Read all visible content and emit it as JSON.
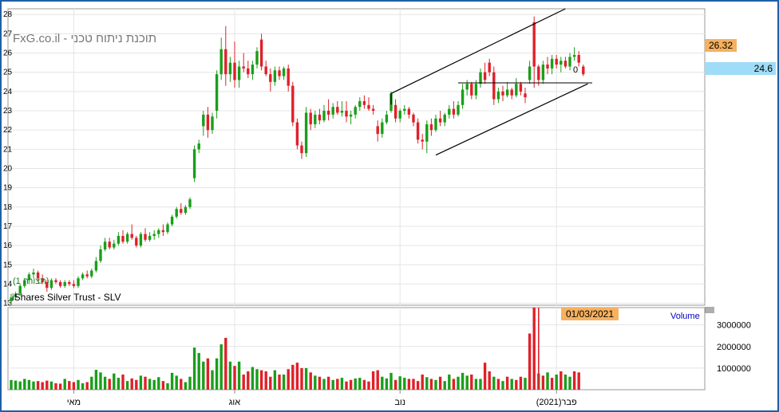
{
  "watermark": "FxG.co.il - תוכנת ניתוח טכני",
  "instrument": "iShares Silver Trust - SLV",
  "period_label": "(1 תצורה)",
  "last_price_tag": "26.32",
  "level_tag": "24.6",
  "date_tag": "01/03/2021",
  "channel_marker": "0",
  "volume_title": "Volume",
  "colors": {
    "up": "#1a9e1a",
    "down": "#e0202a",
    "border": "#1f5fa8",
    "last_tag": "#f6b15e",
    "level_tag": "#9fdcf7",
    "date_tag": "#f6b15e",
    "volume_title": "#0000c0"
  },
  "chart_data": [
    {
      "type": "candlestick",
      "title": "iShares Silver Trust - SLV",
      "y_ticks": [
        13,
        14,
        15,
        16,
        17,
        18,
        19,
        20,
        21,
        22,
        23,
        24,
        25,
        26,
        27,
        28
      ],
      "ylim": [
        12.9,
        28.3
      ],
      "x_ticks": [
        "מאי",
        "אוג",
        "נוב",
        "פבר(2021)"
      ],
      "grid": true,
      "candles": [
        {
          "o": 13.1,
          "h": 13.5,
          "l": 12.9,
          "c": 13.3
        },
        {
          "o": 13.3,
          "h": 13.6,
          "l": 13.2,
          "c": 13.5
        },
        {
          "o": 13.5,
          "h": 14.0,
          "l": 13.4,
          "c": 13.9
        },
        {
          "o": 13.9,
          "h": 14.3,
          "l": 13.8,
          "c": 14.2
        },
        {
          "o": 14.2,
          "h": 14.6,
          "l": 14.0,
          "c": 14.5
        },
        {
          "o": 14.5,
          "h": 14.8,
          "l": 14.3,
          "c": 14.6
        },
        {
          "o": 14.6,
          "h": 14.7,
          "l": 14.2,
          "c": 14.3
        },
        {
          "o": 14.3,
          "h": 14.5,
          "l": 14.0,
          "c": 14.1
        },
        {
          "o": 14.1,
          "h": 14.2,
          "l": 13.6,
          "c": 13.8
        },
        {
          "o": 13.8,
          "h": 14.3,
          "l": 13.7,
          "c": 14.2
        },
        {
          "o": 14.2,
          "h": 14.3,
          "l": 14.0,
          "c": 14.1
        },
        {
          "o": 14.1,
          "h": 14.2,
          "l": 13.8,
          "c": 13.9
        },
        {
          "o": 13.9,
          "h": 14.2,
          "l": 13.8,
          "c": 14.1
        },
        {
          "o": 14.1,
          "h": 14.2,
          "l": 13.9,
          "c": 14.0
        },
        {
          "o": 14.0,
          "h": 14.2,
          "l": 13.8,
          "c": 13.9
        },
        {
          "o": 13.9,
          "h": 14.4,
          "l": 13.8,
          "c": 14.3
        },
        {
          "o": 14.3,
          "h": 14.6,
          "l": 14.2,
          "c": 14.5
        },
        {
          "o": 14.5,
          "h": 14.7,
          "l": 14.3,
          "c": 14.4
        },
        {
          "o": 14.4,
          "h": 14.8,
          "l": 14.3,
          "c": 14.7
        },
        {
          "o": 14.7,
          "h": 15.4,
          "l": 14.6,
          "c": 15.2
        },
        {
          "o": 15.2,
          "h": 16.0,
          "l": 15.1,
          "c": 15.8
        },
        {
          "o": 15.8,
          "h": 16.4,
          "l": 15.7,
          "c": 16.2
        },
        {
          "o": 16.2,
          "h": 16.4,
          "l": 15.8,
          "c": 15.9
        },
        {
          "o": 15.9,
          "h": 16.3,
          "l": 15.8,
          "c": 16.1
        },
        {
          "o": 16.1,
          "h": 16.7,
          "l": 16.0,
          "c": 16.5
        },
        {
          "o": 16.5,
          "h": 16.8,
          "l": 16.1,
          "c": 16.2
        },
        {
          "o": 16.2,
          "h": 16.7,
          "l": 16.1,
          "c": 16.6
        },
        {
          "o": 16.6,
          "h": 17.1,
          "l": 16.3,
          "c": 16.4
        },
        {
          "o": 16.4,
          "h": 16.5,
          "l": 15.9,
          "c": 16.0
        },
        {
          "o": 16.0,
          "h": 16.7,
          "l": 15.9,
          "c": 16.6
        },
        {
          "o": 16.6,
          "h": 16.9,
          "l": 16.2,
          "c": 16.3
        },
        {
          "o": 16.3,
          "h": 16.7,
          "l": 16.2,
          "c": 16.5
        },
        {
          "o": 16.5,
          "h": 16.8,
          "l": 16.3,
          "c": 16.6
        },
        {
          "o": 16.6,
          "h": 16.9,
          "l": 16.4,
          "c": 16.8
        },
        {
          "o": 16.8,
          "h": 17.1,
          "l": 16.5,
          "c": 16.7
        },
        {
          "o": 16.7,
          "h": 17.2,
          "l": 16.6,
          "c": 17.1
        },
        {
          "o": 17.1,
          "h": 17.6,
          "l": 17.0,
          "c": 17.5
        },
        {
          "o": 17.5,
          "h": 18.0,
          "l": 17.4,
          "c": 17.9
        },
        {
          "o": 17.9,
          "h": 18.2,
          "l": 17.6,
          "c": 17.7
        },
        {
          "o": 17.7,
          "h": 18.1,
          "l": 17.6,
          "c": 18.0
        },
        {
          "o": 18.0,
          "h": 18.5,
          "l": 17.9,
          "c": 18.4
        },
        {
          "o": 19.5,
          "h": 21.2,
          "l": 19.3,
          "c": 21.0
        },
        {
          "o": 21.0,
          "h": 21.5,
          "l": 20.8,
          "c": 21.3
        },
        {
          "o": 22.2,
          "h": 23.0,
          "l": 21.7,
          "c": 22.8
        },
        {
          "o": 22.8,
          "h": 23.2,
          "l": 21.6,
          "c": 22.0
        },
        {
          "o": 22.0,
          "h": 22.9,
          "l": 21.8,
          "c": 22.7
        },
        {
          "o": 23.0,
          "h": 25.1,
          "l": 22.6,
          "c": 24.9
        },
        {
          "o": 24.9,
          "h": 26.8,
          "l": 24.6,
          "c": 26.2
        },
        {
          "o": 26.2,
          "h": 27.4,
          "l": 24.3,
          "c": 24.9
        },
        {
          "o": 24.9,
          "h": 25.8,
          "l": 24.5,
          "c": 25.5
        },
        {
          "o": 25.5,
          "h": 26.6,
          "l": 24.2,
          "c": 24.6
        },
        {
          "o": 24.6,
          "h": 25.6,
          "l": 24.2,
          "c": 25.3
        },
        {
          "o": 25.3,
          "h": 26.0,
          "l": 25.0,
          "c": 25.2
        },
        {
          "o": 25.2,
          "h": 25.6,
          "l": 24.7,
          "c": 24.9
        },
        {
          "o": 24.9,
          "h": 25.6,
          "l": 24.6,
          "c": 25.4
        },
        {
          "o": 25.4,
          "h": 26.3,
          "l": 25.2,
          "c": 26.1
        },
        {
          "o": 26.7,
          "h": 27.0,
          "l": 25.1,
          "c": 25.3
        },
        {
          "o": 25.3,
          "h": 25.6,
          "l": 24.8,
          "c": 24.9
        },
        {
          "o": 24.9,
          "h": 25.2,
          "l": 24.0,
          "c": 24.5
        },
        {
          "o": 24.5,
          "h": 25.3,
          "l": 24.3,
          "c": 25.1
        },
        {
          "o": 25.1,
          "h": 25.3,
          "l": 24.6,
          "c": 24.8
        },
        {
          "o": 24.8,
          "h": 25.3,
          "l": 24.6,
          "c": 25.2
        },
        {
          "o": 25.2,
          "h": 25.4,
          "l": 24.0,
          "c": 24.3
        },
        {
          "o": 24.3,
          "h": 24.5,
          "l": 22.2,
          "c": 22.4
        },
        {
          "o": 22.4,
          "h": 22.6,
          "l": 21.0,
          "c": 21.2
        },
        {
          "o": 21.2,
          "h": 21.4,
          "l": 20.5,
          "c": 20.8
        },
        {
          "o": 20.8,
          "h": 23.2,
          "l": 20.6,
          "c": 22.9
        },
        {
          "o": 22.9,
          "h": 23.1,
          "l": 22.0,
          "c": 22.3
        },
        {
          "o": 22.3,
          "h": 23.0,
          "l": 22.1,
          "c": 22.8
        },
        {
          "o": 22.8,
          "h": 23.1,
          "l": 22.3,
          "c": 22.5
        },
        {
          "o": 22.5,
          "h": 23.3,
          "l": 22.4,
          "c": 23.0
        },
        {
          "o": 23.0,
          "h": 23.6,
          "l": 22.5,
          "c": 22.8
        },
        {
          "o": 22.8,
          "h": 23.4,
          "l": 22.6,
          "c": 23.2
        },
        {
          "o": 23.2,
          "h": 23.5,
          "l": 22.8,
          "c": 22.9
        },
        {
          "o": 22.9,
          "h": 23.5,
          "l": 22.7,
          "c": 23.0
        },
        {
          "o": 23.0,
          "h": 23.5,
          "l": 22.4,
          "c": 22.7
        },
        {
          "o": 22.7,
          "h": 23.0,
          "l": 22.3,
          "c": 22.8
        },
        {
          "o": 22.8,
          "h": 23.3,
          "l": 22.6,
          "c": 23.2
        },
        {
          "o": 23.2,
          "h": 23.7,
          "l": 23.0,
          "c": 23.5
        },
        {
          "o": 23.5,
          "h": 23.8,
          "l": 23.1,
          "c": 23.3
        },
        {
          "o": 23.3,
          "h": 23.7,
          "l": 23.0,
          "c": 23.1
        },
        {
          "o": 23.1,
          "h": 23.3,
          "l": 22.8,
          "c": 23.0
        },
        {
          "o": 22.2,
          "h": 22.5,
          "l": 21.4,
          "c": 21.8
        },
        {
          "o": 21.8,
          "h": 22.6,
          "l": 21.6,
          "c": 22.4
        },
        {
          "o": 22.4,
          "h": 23.0,
          "l": 22.3,
          "c": 22.8
        },
        {
          "o": 23.0,
          "h": 24.0,
          "l": 22.9,
          "c": 23.9
        },
        {
          "o": 23.3,
          "h": 23.6,
          "l": 22.4,
          "c": 22.6
        },
        {
          "o": 22.6,
          "h": 23.1,
          "l": 22.4,
          "c": 23.0
        },
        {
          "o": 23.0,
          "h": 23.3,
          "l": 22.8,
          "c": 23.1
        },
        {
          "o": 23.1,
          "h": 23.2,
          "l": 22.6,
          "c": 22.8
        },
        {
          "o": 22.8,
          "h": 22.9,
          "l": 22.2,
          "c": 22.4
        },
        {
          "o": 22.4,
          "h": 22.6,
          "l": 21.3,
          "c": 21.5
        },
        {
          "o": 21.5,
          "h": 21.8,
          "l": 21.0,
          "c": 21.4
        },
        {
          "o": 21.4,
          "h": 22.5,
          "l": 20.8,
          "c": 22.3
        },
        {
          "o": 22.3,
          "h": 22.6,
          "l": 21.7,
          "c": 22.0
        },
        {
          "o": 22.0,
          "h": 22.8,
          "l": 21.9,
          "c": 22.6
        },
        {
          "o": 22.6,
          "h": 23.0,
          "l": 22.2,
          "c": 22.4
        },
        {
          "o": 22.4,
          "h": 22.9,
          "l": 22.2,
          "c": 22.8
        },
        {
          "o": 22.8,
          "h": 23.3,
          "l": 22.6,
          "c": 23.1
        },
        {
          "o": 23.1,
          "h": 23.5,
          "l": 22.6,
          "c": 22.8
        },
        {
          "o": 22.8,
          "h": 23.5,
          "l": 22.7,
          "c": 23.3
        },
        {
          "o": 23.3,
          "h": 24.4,
          "l": 23.1,
          "c": 24.1
        },
        {
          "o": 24.1,
          "h": 24.6,
          "l": 23.8,
          "c": 24.4
        },
        {
          "o": 24.4,
          "h": 24.5,
          "l": 23.6,
          "c": 23.8
        },
        {
          "o": 23.8,
          "h": 24.6,
          "l": 23.6,
          "c": 24.4
        },
        {
          "o": 24.4,
          "h": 25.2,
          "l": 24.2,
          "c": 25.0
        },
        {
          "o": 25.0,
          "h": 25.5,
          "l": 24.4,
          "c": 24.6
        },
        {
          "o": 25.5,
          "h": 25.7,
          "l": 24.8,
          "c": 25.0
        },
        {
          "o": 25.0,
          "h": 25.3,
          "l": 23.3,
          "c": 23.6
        },
        {
          "o": 23.6,
          "h": 24.2,
          "l": 23.4,
          "c": 24.0
        },
        {
          "o": 24.0,
          "h": 24.3,
          "l": 23.5,
          "c": 23.8
        },
        {
          "o": 23.8,
          "h": 24.5,
          "l": 23.7,
          "c": 24.1
        },
        {
          "o": 24.1,
          "h": 24.2,
          "l": 23.6,
          "c": 23.8
        },
        {
          "o": 23.8,
          "h": 24.7,
          "l": 23.7,
          "c": 24.4
        },
        {
          "o": 24.4,
          "h": 24.5,
          "l": 23.8,
          "c": 24.0
        },
        {
          "o": 23.9,
          "h": 24.2,
          "l": 23.4,
          "c": 23.7
        },
        {
          "o": 24.6,
          "h": 25.6,
          "l": 24.4,
          "c": 25.3
        },
        {
          "o": 27.6,
          "h": 27.9,
          "l": 24.2,
          "c": 25.3
        },
        {
          "o": 25.3,
          "h": 25.4,
          "l": 24.3,
          "c": 24.6
        },
        {
          "o": 24.6,
          "h": 25.6,
          "l": 24.4,
          "c": 25.4
        },
        {
          "o": 25.4,
          "h": 25.8,
          "l": 24.9,
          "c": 25.2
        },
        {
          "o": 25.2,
          "h": 25.9,
          "l": 24.9,
          "c": 25.7
        },
        {
          "o": 25.7,
          "h": 25.9,
          "l": 25.2,
          "c": 25.4
        },
        {
          "o": 25.4,
          "h": 25.8,
          "l": 25.0,
          "c": 25.6
        },
        {
          "o": 25.6,
          "h": 25.8,
          "l": 25.2,
          "c": 25.3
        },
        {
          "o": 25.3,
          "h": 26.0,
          "l": 25.1,
          "c": 25.8
        },
        {
          "o": 25.8,
          "h": 26.3,
          "l": 25.6,
          "c": 25.9
        },
        {
          "o": 25.9,
          "h": 26.1,
          "l": 25.3,
          "c": 25.5
        },
        {
          "o": 25.3,
          "h": 25.4,
          "l": 24.8,
          "c": 24.9
        }
      ],
      "annotations": {
        "channel_upper": {
          "from": {
            "i": 85,
            "p": 23.9
          },
          "to": {
            "i": 124,
            "p": 28.3
          }
        },
        "channel_lower": {
          "from": {
            "i": 95,
            "p": 20.7
          },
          "to": {
            "i": 129,
            "p": 24.4
          }
        },
        "horizontal_level": {
          "p": 24.45,
          "from_i": 100,
          "to_i": 130
        }
      }
    },
    {
      "type": "bar",
      "title": "Volume",
      "y_ticks": [
        1000000,
        2000000,
        3000000
      ],
      "y_tick_labels": [
        "1000000",
        "2000000",
        "3000000"
      ],
      "ylim": [
        0,
        3800000
      ],
      "values": [
        450000,
        420000,
        380000,
        500000,
        450000,
        380000,
        400000,
        350000,
        420000,
        380000,
        300000,
        280000,
        500000,
        400000,
        350000,
        450000,
        300000,
        350000,
        600000,
        920000,
        800000,
        600000,
        500000,
        750000,
        550000,
        700000,
        400000,
        520000,
        450000,
        650000,
        600000,
        500000,
        450000,
        580000,
        400000,
        300000,
        780000,
        650000,
        500000,
        350000,
        600000,
        1950000,
        1700000,
        1300000,
        1450000,
        900000,
        1450000,
        2100000,
        2400000,
        1300000,
        1100000,
        1300000,
        700000,
        850000,
        1050000,
        950000,
        900000,
        850000,
        600000,
        900000,
        700000,
        700000,
        950000,
        1150000,
        1250000,
        1000000,
        1000000,
        800000,
        650000,
        600000,
        500000,
        600000,
        450000,
        500000,
        550000,
        380000,
        450000,
        520000,
        550000,
        450000,
        380000,
        850000,
        900000,
        600000,
        520000,
        780000,
        450000,
        620000,
        550000,
        500000,
        500000,
        400000,
        700000,
        580000,
        500000,
        450000,
        600000,
        400000,
        700000,
        500000,
        600000,
        780000,
        650000,
        700000,
        500000,
        500000,
        1250000,
        850000,
        600000,
        500000,
        400000,
        600000,
        500000,
        450000,
        600000,
        550000,
        2600000,
        3800000,
        750000,
        650000,
        800000,
        550000,
        700000,
        850000,
        700000,
        600000,
        850000,
        800000
      ],
      "up_flags": [
        1,
        1,
        1,
        1,
        1,
        1,
        0,
        0,
        0,
        1,
        0,
        0,
        1,
        0,
        0,
        1,
        1,
        0,
        1,
        1,
        1,
        1,
        0,
        1,
        1,
        0,
        1,
        0,
        0,
        1,
        0,
        1,
        1,
        1,
        0,
        1,
        1,
        1,
        0,
        1,
        1,
        1,
        1,
        1,
        0,
        1,
        1,
        1,
        0,
        1,
        0,
        1,
        0,
        0,
        1,
        1,
        0,
        0,
        0,
        1,
        0,
        1,
        0,
        0,
        0,
        0,
        1,
        0,
        1,
        0,
        1,
        0,
        1,
        0,
        1,
        0,
        0,
        1,
        1,
        0,
        0,
        0,
        0,
        1,
        1,
        1,
        0,
        1,
        1,
        0,
        0,
        0,
        0,
        1,
        0,
        1,
        0,
        1,
        1,
        0,
        1,
        1,
        1,
        0,
        1,
        1,
        0,
        0,
        1,
        0,
        1,
        0,
        1,
        0,
        0,
        1,
        0,
        0,
        1,
        0,
        1,
        0,
        1,
        0,
        1,
        1,
        0,
        0
      ]
    }
  ]
}
